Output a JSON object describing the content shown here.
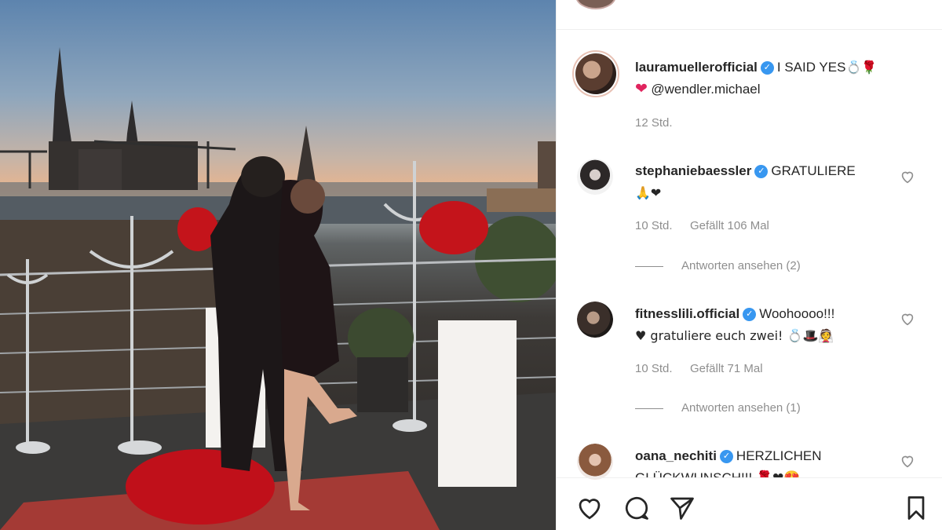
{
  "post": {
    "author": "lauramuellerofficial",
    "caption": "I SAID YES",
    "caption_emoji": "💍🌹",
    "caption_line2_emoji": "❤",
    "caption_mention": "@wendler.michael",
    "time": "12 Std."
  },
  "comments": [
    {
      "username": "stephaniebaessler",
      "text": "GRATULIERE",
      "line2": "🙏❤",
      "time": "10 Std.",
      "likes": "Gefällt 106 Mal",
      "replies": "Antworten ansehen (2)"
    },
    {
      "username": "fitnesslili.official",
      "text": "Woohoooo!!!",
      "line2": "♥ gratuliere euch zwei! 💍🎩👰",
      "time": "10 Std.",
      "likes": "Gefällt 71 Mal",
      "replies": "Antworten ansehen (1)"
    },
    {
      "username": "oana_nechiti",
      "text": "HERZLICHEN",
      "line2": "GLÜCKWUNSCH!!! 🌹❤😍"
    }
  ],
  "icons": {
    "like": "heart-icon",
    "comment": "comment-icon",
    "share": "share-icon",
    "save": "bookmark-icon",
    "verified": "verified-badge-icon",
    "comment_like": "heart-outline-icon"
  },
  "colors": {
    "verified": "#3897f0",
    "muted_text": "#8e8e8e",
    "heart_red": "#e0245e"
  }
}
